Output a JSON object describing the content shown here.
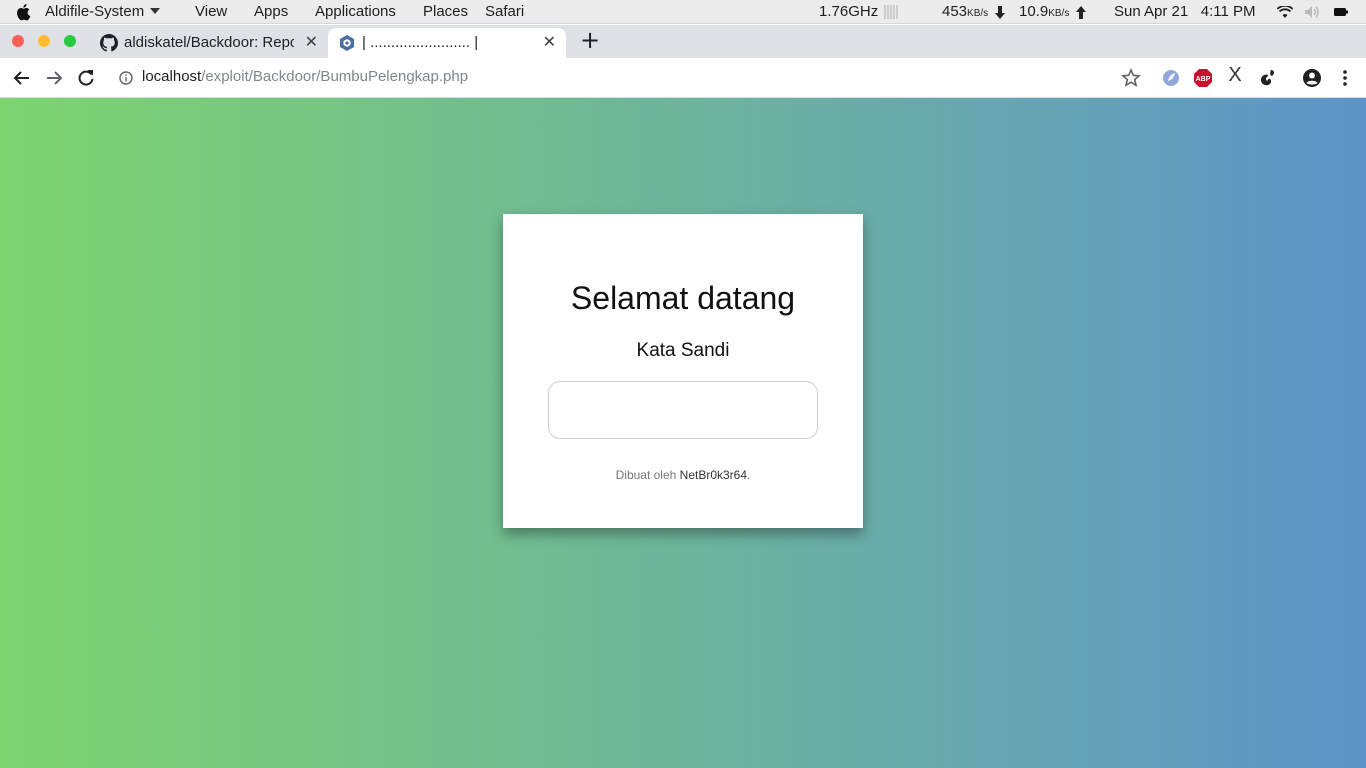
{
  "system_bar": {
    "app_name": "Aldifile-System",
    "menus": [
      "View",
      "Apps",
      "Applications",
      "Places",
      "Safari"
    ],
    "cpu": "1.76GHz",
    "download_value": "453",
    "download_unit": "KB/s",
    "upload_value": "10.9",
    "upload_unit": "KB/s",
    "datetime": "Sun Apr 21   4:11 PM"
  },
  "window_controls": {
    "close_color": "#ff5f57",
    "minimize_color": "#febc2e",
    "maximize_color": "#28c840"
  },
  "tabs": [
    {
      "title": "aldiskatel/Backdoor: Repo",
      "icon": "github-icon",
      "active": false
    },
    {
      "title": "| ........................ |",
      "icon": "hexagon-icon",
      "active": true
    }
  ],
  "address_bar": {
    "host": "localhost",
    "path": "/exploit/Backdoor/BumbuPelengkap.php"
  },
  "extensions": [
    "bookmark-star-icon",
    "extension-blue-icon",
    "adblock-icon",
    "x-icon",
    "gnome-icon",
    "account-icon",
    "menu-icon"
  ],
  "extension_text": {
    "adblock": "ABP",
    "x": "X"
  },
  "page": {
    "heading": "Selamat datang",
    "password_label": "Kata Sandi",
    "password_value": "",
    "credit_prefix": "Dibuat oleh ",
    "credit_author": "NetBr0k3r64",
    "credit_suffix": ".",
    "gradient_start": "#7dd56f",
    "gradient_end": "#5e94c9"
  }
}
